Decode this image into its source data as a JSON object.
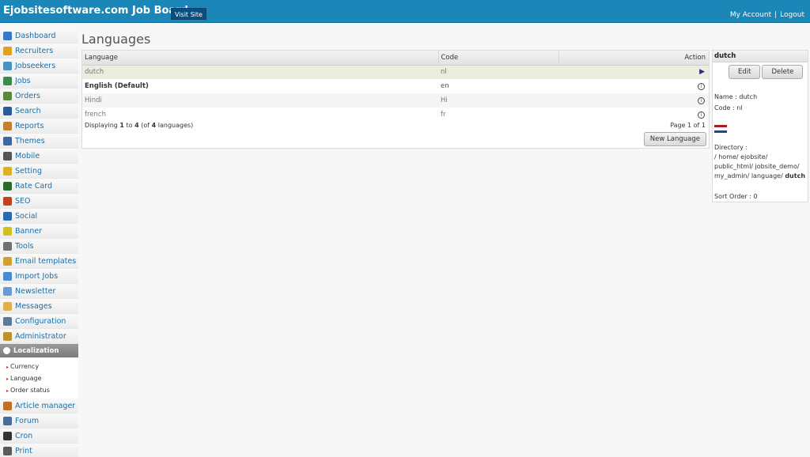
{
  "header": {
    "brand": "Ejobsitesoftware.com Job Board",
    "visit_site": "Visit Site",
    "my_account": "My Account",
    "separator": "|",
    "logout": "Logout"
  },
  "sidebar": {
    "items": [
      {
        "label": "Dashboard",
        "icon": "home-icon",
        "color": "#3a78c3"
      },
      {
        "label": "Recruiters",
        "icon": "user-icon",
        "color": "#e0a020"
      },
      {
        "label": "Jobseekers",
        "icon": "users-icon",
        "color": "#4a90c0"
      },
      {
        "label": "Jobs",
        "icon": "briefcase-icon",
        "color": "#3a8a4a"
      },
      {
        "label": "Orders",
        "icon": "orders-icon",
        "color": "#5a8a3a"
      },
      {
        "label": "Search",
        "icon": "search-icon",
        "color": "#2a5a9a"
      },
      {
        "label": "Reports",
        "icon": "book-icon",
        "color": "#c08030"
      },
      {
        "label": "Themes",
        "icon": "themes-icon",
        "color": "#3a6aa0"
      },
      {
        "label": "Mobile",
        "icon": "mobile-icon",
        "color": "#555555"
      },
      {
        "label": "Setting",
        "icon": "gear-icon",
        "color": "#e0b020"
      },
      {
        "label": "Rate Card",
        "icon": "dollar-icon",
        "color": "#2a6a2a"
      },
      {
        "label": "SEO",
        "icon": "seo-chart-icon",
        "color": "#c04020"
      },
      {
        "label": "Social",
        "icon": "globe-icon",
        "color": "#2a6ab0"
      },
      {
        "label": "Banner",
        "icon": "banner-icon",
        "color": "#d0c020"
      },
      {
        "label": "Tools",
        "icon": "tools-icon",
        "color": "#707070"
      },
      {
        "label": "Email templates",
        "icon": "email-icon",
        "color": "#d0a030"
      },
      {
        "label": "Import Jobs",
        "icon": "import-icon",
        "color": "#4a8ad0"
      },
      {
        "label": "Newsletter",
        "icon": "newsletter-icon",
        "color": "#6a9ad0"
      },
      {
        "label": "Messages",
        "icon": "messages-icon",
        "color": "#e0b050"
      },
      {
        "label": "Configuration",
        "icon": "configuration-icon",
        "color": "#5a7a9a"
      },
      {
        "label": "Administrator",
        "icon": "admin-icon",
        "color": "#c09030"
      },
      {
        "label": "Localization",
        "icon": "localization-icon",
        "color": "#ffffff",
        "active": true
      },
      {
        "label": "Article manager",
        "icon": "article-icon",
        "color": "#c07020"
      },
      {
        "label": "Forum",
        "icon": "forum-icon",
        "color": "#4a6a9a"
      },
      {
        "label": "Cron",
        "icon": "clock-icon",
        "color": "#333333"
      },
      {
        "label": "Print",
        "icon": "printer-icon",
        "color": "#5a5a5a"
      }
    ],
    "sub_items": [
      "Currency",
      "Language",
      "Order status"
    ]
  },
  "main": {
    "title": "Languages",
    "table": {
      "headers": [
        "Language",
        "Code",
        "Action"
      ],
      "rows": [
        {
          "language": "dutch",
          "code": "nl",
          "action": "play-icon"
        },
        {
          "language": "English (Default)",
          "code": "en",
          "action": "info-icon"
        },
        {
          "language": "Hindi",
          "code": "Hi",
          "action": "info-icon"
        },
        {
          "language": "french",
          "code": "fr",
          "action": "info-icon"
        }
      ],
      "display_prefix": "Displaying",
      "display_from": "1",
      "display_to_word": "to",
      "display_to": "4",
      "display_of_open": "(of",
      "display_total": "4",
      "display_suffix": "languages)",
      "page_info": "Page 1 of 1",
      "new_language": "New Language"
    }
  },
  "detail": {
    "header": "dutch",
    "edit": "Edit",
    "delete": "Delete",
    "name_line": "Name : dutch",
    "code_line": "Code : nl",
    "directory_label": "Directory :",
    "directory_path_1": "/ home/ ejobsite/",
    "directory_path_2": "public_html/ jobsite_demo/",
    "directory_path_3": "my_admin/ language/",
    "directory_leaf": "dutch",
    "sort_order": "Sort Order : 0",
    "flag_colors": [
      "#ae1c28",
      "#ffffff",
      "#21468b"
    ]
  }
}
